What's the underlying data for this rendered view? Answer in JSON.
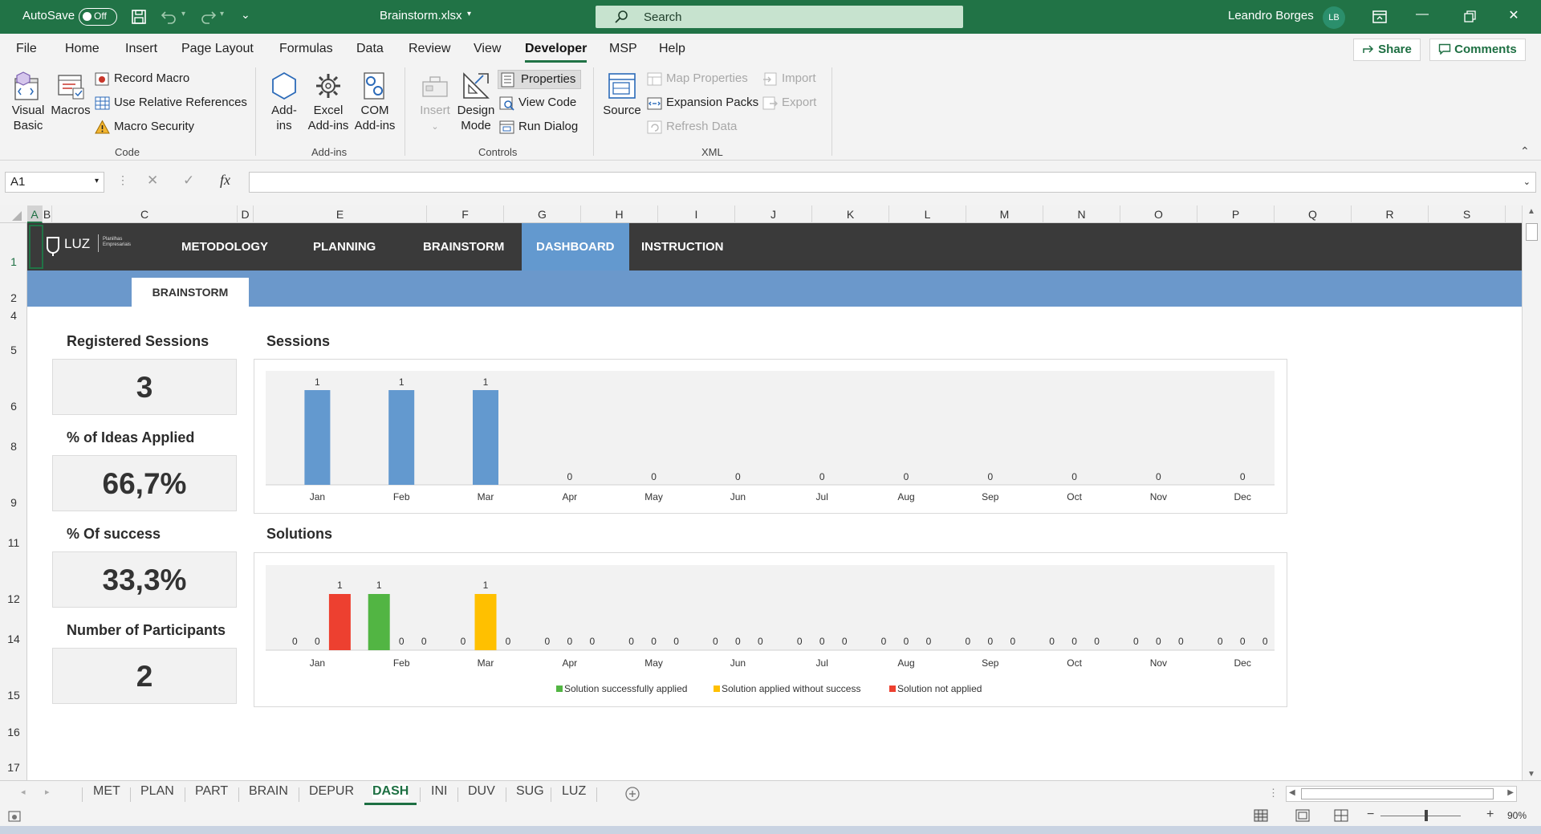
{
  "titlebar": {
    "autosave_label": "AutoSave",
    "autosave_state": "Off",
    "filename": "Brainstorm.xlsx",
    "search_placeholder": "Search",
    "user_name": "Leandro Borges",
    "user_initials": "LB"
  },
  "menu": {
    "tabs": [
      "File",
      "Home",
      "Insert",
      "Page Layout",
      "Formulas",
      "Data",
      "Review",
      "View",
      "Developer",
      "MSP",
      "Help"
    ],
    "active": "Developer",
    "share_label": "Share",
    "comments_label": "Comments"
  },
  "ribbon": {
    "code": {
      "visual_basic": [
        "Visual",
        "Basic"
      ],
      "macros": "Macros",
      "record_macro": "Record Macro",
      "relative_refs": "Use Relative References",
      "macro_security": "Macro Security",
      "group_label": "Code"
    },
    "addins": {
      "addins": [
        "Add-",
        "ins"
      ],
      "excel_addins": [
        "Excel",
        "Add-ins"
      ],
      "com_addins": [
        "COM",
        "Add-ins"
      ],
      "group_label": "Add-ins"
    },
    "controls": {
      "insert": "Insert",
      "design_mode": [
        "Design",
        "Mode"
      ],
      "properties": "Properties",
      "view_code": "View Code",
      "run_dialog": "Run Dialog",
      "group_label": "Controls"
    },
    "xml": {
      "source": "Source",
      "map_properties": "Map Properties",
      "expansion_packs": "Expansion Packs",
      "refresh_data": "Refresh Data",
      "import": "Import",
      "export": "Export",
      "group_label": "XML"
    }
  },
  "formula_bar": {
    "name_box": "A1",
    "fx_symbol": "fx",
    "value": ""
  },
  "columns": [
    "A",
    "B",
    "C",
    "D",
    "E",
    "F",
    "G",
    "H",
    "I",
    "J",
    "K",
    "L",
    "M",
    "N",
    "O",
    "P",
    "Q",
    "R",
    "S"
  ],
  "rows": [
    "1",
    "2",
    "4",
    "5",
    "6",
    "8",
    "9",
    "11",
    "12",
    "14",
    "15",
    "16",
    "17"
  ],
  "sheet": {
    "logo_text": "LUZ",
    "logo_sub": [
      "Planilhas",
      "Empresariais"
    ],
    "nav": [
      "METODOLOGY",
      "PLANNING",
      "BRAINSTORM",
      "DASHBOARD",
      "INSTRUCTION"
    ],
    "nav_active": "DASHBOARD",
    "subtab": "BRAINSTORM",
    "kpis": [
      {
        "label": "Registered Sessions",
        "value": "3"
      },
      {
        "label": "% of Ideas Applied",
        "value": "66,7%"
      },
      {
        "label": "% Of success",
        "value": "33,3%"
      },
      {
        "label": "Number of Participants",
        "value": "2"
      }
    ]
  },
  "chart_data": [
    {
      "type": "bar",
      "title": "Sessions",
      "categories": [
        "Jan",
        "Feb",
        "Mar",
        "Apr",
        "May",
        "Jun",
        "Jul",
        "Aug",
        "Sep",
        "Oct",
        "Nov",
        "Dec"
      ],
      "values": [
        1,
        1,
        1,
        0,
        0,
        0,
        0,
        0,
        0,
        0,
        0,
        0
      ],
      "ylim": [
        0,
        1
      ],
      "color": "#6399cf",
      "data_labels": true,
      "grid": false
    },
    {
      "type": "bar",
      "title": "Solutions",
      "categories": [
        "Jan",
        "Feb",
        "Mar",
        "Apr",
        "May",
        "Jun",
        "Jul",
        "Aug",
        "Sep",
        "Oct",
        "Nov",
        "Dec"
      ],
      "series": [
        {
          "name": "Solution not applied",
          "color": "#ed4030",
          "values": [
            1,
            0,
            0,
            0,
            0,
            0,
            0,
            0,
            0,
            0,
            0,
            0
          ]
        },
        {
          "name": "Solution successfully applied",
          "color": "#52b543",
          "values": [
            0,
            1,
            0,
            0,
            0,
            0,
            0,
            0,
            0,
            0,
            0,
            0
          ]
        },
        {
          "name": "Solution applied without success",
          "color": "#ffc000",
          "values": [
            0,
            0,
            1,
            0,
            0,
            0,
            0,
            0,
            0,
            0,
            0,
            0
          ]
        }
      ],
      "series_order_in_group": [
        "Solution successfully applied",
        "Solution applied without success",
        "Solution not applied"
      ],
      "legend_order": [
        "Solution successfully applied",
        "Solution applied without success",
        "Solution not applied"
      ],
      "legend_position": "bottom",
      "ylim": [
        0,
        1
      ],
      "data_labels": true,
      "grid": false
    }
  ],
  "sheet_tabs": [
    "MET",
    "PLAN",
    "PART",
    "BRAIN",
    "DEPUR",
    "DASH",
    "INI",
    "DUV",
    "SUG",
    "LUZ"
  ],
  "active_sheet": "DASH",
  "status": {
    "zoom": "90%"
  },
  "colors": {
    "excel_green": "#217346",
    "nav_dark": "#3a3a3a",
    "nav_active": "#6399cf",
    "band_blue": "#6b98cb"
  }
}
